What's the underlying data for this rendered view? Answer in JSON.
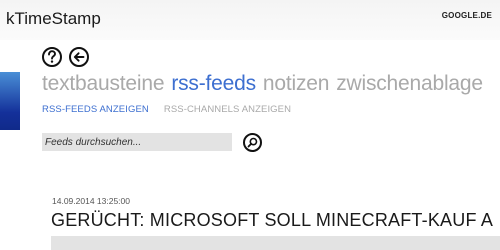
{
  "app": {
    "title": "kTimeStamp",
    "site_link": "GOOGLE.DE"
  },
  "toolbar": {
    "help_icon": "help-circle-icon",
    "back_icon": "back-arrow-icon"
  },
  "pivot": {
    "items": [
      {
        "label": "textbausteine",
        "active": false
      },
      {
        "label": "rss-feeds",
        "active": true
      },
      {
        "label": "notizen",
        "active": false
      },
      {
        "label": "zwischenablage",
        "active": false
      }
    ]
  },
  "subnav": {
    "items": [
      {
        "label": "RSS-FEEDS ANZEIGEN",
        "active": true
      },
      {
        "label": "RSS-CHANNELS ANZEIGEN",
        "active": false
      }
    ]
  },
  "search": {
    "placeholder": "Feeds durchsuchen...",
    "value": "",
    "icon": "search-icon"
  },
  "feed": {
    "date": "14.09.2014 13:25:00",
    "title": "GERÜCHT: MICROSOFT SOLL MINECRAFT-KAUF A"
  },
  "colors": {
    "accent": "#3d6fd0",
    "inactive": "#a9a9a9",
    "accent_bar_top": "#4a8fd6",
    "accent_bar_bottom": "#102a8a"
  }
}
